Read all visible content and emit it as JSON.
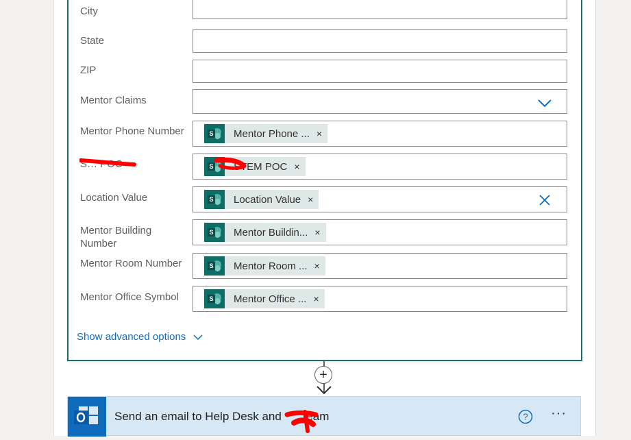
{
  "form": {
    "fields": [
      {
        "id": "city",
        "label": "City",
        "value": ""
      },
      {
        "id": "state",
        "label": "State",
        "value": ""
      },
      {
        "id": "zip",
        "label": "ZIP",
        "value": ""
      },
      {
        "id": "mentor-claims",
        "label": "Mentor Claims",
        "value": ""
      },
      {
        "id": "mentor-phone",
        "label": "Mentor Phone Number",
        "token": "Mentor Phone ..."
      },
      {
        "id": "stem-poc",
        "label": "S… POC",
        "token": "STEM POC"
      },
      {
        "id": "location-value",
        "label": "Location Value",
        "token": "Location Value"
      },
      {
        "id": "mentor-building",
        "label": "Mentor Building Number",
        "token": "Mentor Buildin..."
      },
      {
        "id": "mentor-room",
        "label": "Mentor Room Number",
        "token": "Mentor Room ..."
      },
      {
        "id": "mentor-office",
        "label": "Mentor Office Symbol",
        "token": "Mentor Office ..."
      }
    ],
    "token_remove_glyph": "×",
    "token_icon_letter": "S",
    "show_advanced_label": "Show advanced options"
  },
  "connector": {
    "plus_glyph": "+"
  },
  "action": {
    "title": "Send an email to Help Desk and      Team",
    "more_glyph": "···",
    "help_glyph": "?"
  },
  "colors": {
    "card_border": "#1f6b66",
    "sharepoint_icon": "#0f6d68",
    "token_bg": "#dde8e7",
    "link_blue": "#0f6cbd",
    "action_bg": "#d6e7f6",
    "redaction": "#ff0000"
  }
}
